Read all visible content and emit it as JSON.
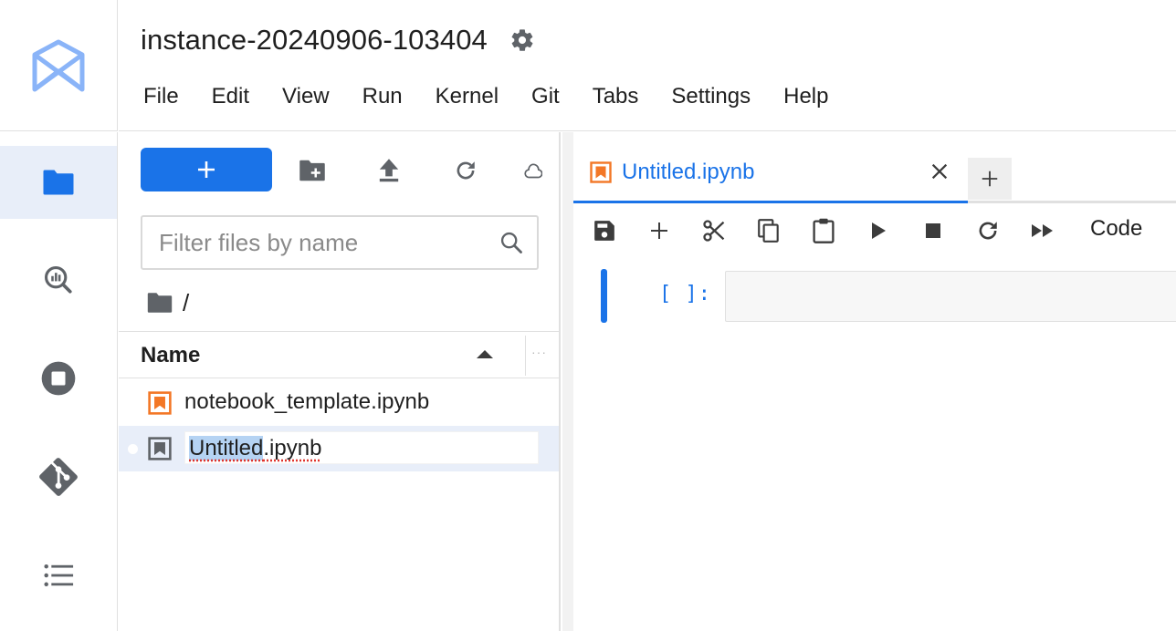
{
  "header": {
    "title": "instance-20240906-103404",
    "menu": [
      "File",
      "Edit",
      "View",
      "Run",
      "Kernel",
      "Git",
      "Tabs",
      "Settings",
      "Help"
    ]
  },
  "activity_bar": {
    "items": [
      {
        "icon": "folder-icon",
        "active": true
      },
      {
        "icon": "dataproc-search-icon",
        "active": false
      },
      {
        "icon": "running-stop-icon",
        "active": false
      },
      {
        "icon": "git-icon",
        "active": false
      },
      {
        "icon": "table-of-contents-icon",
        "active": false
      }
    ]
  },
  "file_browser": {
    "new_button_label": "+",
    "search": {
      "placeholder": "Filter files by name",
      "value": ""
    },
    "breadcrumb": "/",
    "column_name": "Name",
    "files": [
      {
        "name": "notebook_template.ipynb",
        "selected": false
      },
      {
        "name_selected_part": "Untitled",
        "name_rest": ".ipynb",
        "selected": true,
        "renaming": true
      }
    ]
  },
  "notebook": {
    "tab_label": "Untitled.ipynb",
    "cell_type": "Code",
    "cell_prompt": "[ ]:"
  },
  "colors": {
    "accent": "#1a73e8",
    "notebook_icon": "#f37726",
    "selection": "#e8eef9",
    "icon_gray": "#5f6368"
  }
}
